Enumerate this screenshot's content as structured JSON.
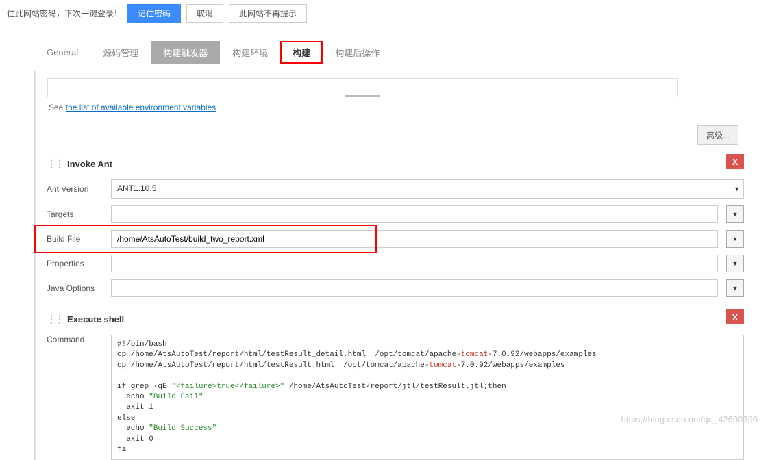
{
  "notification": {
    "text": "住此网站密码，下次一键登录！",
    "remember": "记住密码",
    "cancel": "取消",
    "dismiss": "此网站不再提示"
  },
  "tabs": {
    "general": "General",
    "source": "源码管理",
    "triggers": "构建触发器",
    "env": "构建环境",
    "build": "构建",
    "post": "构建后操作"
  },
  "env_section": {
    "see_prefix": "See ",
    "link_text": "the list of available environment variables"
  },
  "advanced_btn": "高级...",
  "invoke_ant": {
    "title": "Invoke Ant",
    "ant_version_label": "Ant Version",
    "ant_version_value": "ANT1.10.5",
    "targets_label": "Targets",
    "targets_value": "",
    "build_file_label": "Build File",
    "build_file_value": "/home/AtsAutoTest/build_two_report.xml",
    "properties_label": "Properties",
    "properties_value": "",
    "java_options_label": "Java Options",
    "java_options_value": ""
  },
  "execute_shell": {
    "title": "Execute shell",
    "command_label": "Command",
    "command_lines": {
      "l1": "#!/bin/bash",
      "l2a": "cp /home/AtsAutoTest/report/html/testResult_detail.html  /opt/tomcat/apache-",
      "l2b": "tomcat",
      "l2c": "-7.0.92/webapps/examples",
      "l3a": "cp /home/AtsAutoTest/report/html/testResult.html  /opt/tomcat/apache-",
      "l3b": "tomcat",
      "l3c": "-7.0.92/webapps/examples",
      "l4a": "if grep -qE ",
      "l4b": "\"<failure>true</failure>\"",
      "l4c": " /home/AtsAutoTest/report/jtl/testResult.jtl;then",
      "l5a": "  echo ",
      "l5b": "\"Build Fail\"",
      "l6": "  exit 1",
      "l7": "else",
      "l8a": "  echo ",
      "l8b": "\"Build Success\"",
      "l9": "  exit 0",
      "l10": "fi"
    }
  },
  "delete_label": "X",
  "watermark": "https://blog.csdn.net/qq_42600396"
}
